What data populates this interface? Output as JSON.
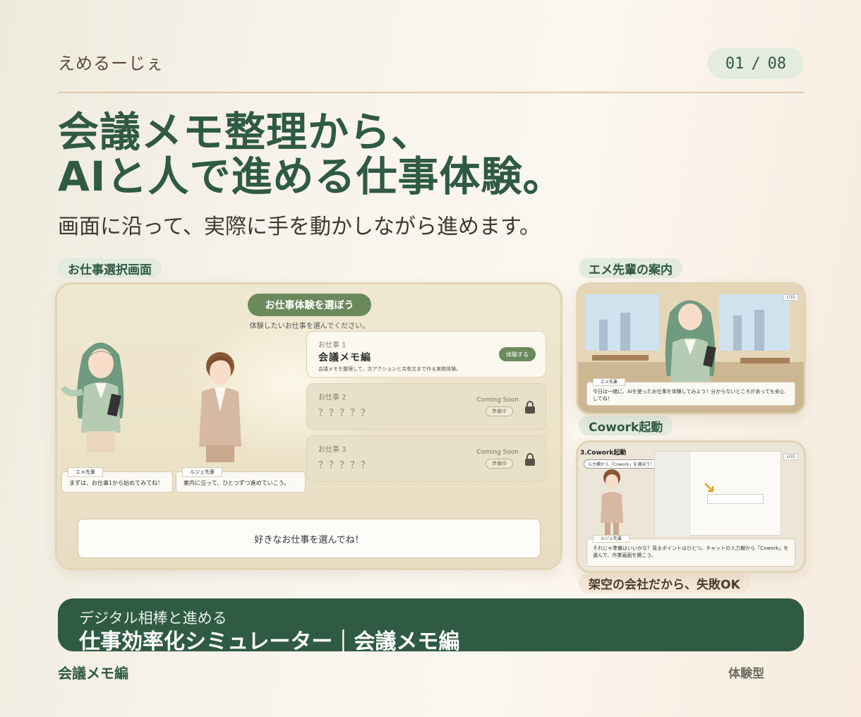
{
  "header": {
    "brand": "えめるーじぇ",
    "page_current": "01",
    "page_sep": "/",
    "page_total": "08"
  },
  "hero": {
    "title_line1": "会議メモ整理から、",
    "title_line2": "AIと人で進める仕事体験。",
    "subtitle": "画面に沿って、実際に手を動かしながら進めます。"
  },
  "labels": {
    "main_screen": "お仕事選択画面",
    "guide": "エメ先輩の案内",
    "cowork": "Cowork起動",
    "fail_ok": "架空の会社だから、失敗OK"
  },
  "main_screen": {
    "choose_button": "お仕事体験を選ぼう",
    "choose_sub": "体験したいお仕事を選んでください。",
    "jobs": [
      {
        "tag": "お仕事 1",
        "name": "会議メモ編",
        "desc": "会議メモを整理して、次アクションと共有文まで作る実務体験。",
        "action": "体験する"
      },
      {
        "tag": "お仕事 2",
        "name": "？？？？？",
        "soon": "Coming Soon",
        "status": "準備中"
      },
      {
        "tag": "お仕事 3",
        "name": "？？？？？",
        "soon": "Coming Soon",
        "status": "準備中"
      }
    ],
    "speech_eme_name": "エメ先輩",
    "speech_eme": "まずは、お仕事1から始めてみてね！",
    "speech_ruje_name": "ルジェ先輩",
    "speech_ruje": "案内に沿って、ひとつずつ進めていこう。",
    "bottom_message": "好きなお仕事を選んでね！"
  },
  "guide_screen": {
    "log": "LOG",
    "speaker": "エメ先輩",
    "text": "今日は一緒に、AIを使ったお仕事を体験してみよう！分からないところがあっても安心してね！"
  },
  "cowork_screen": {
    "heading": "3.Cowork起動",
    "hint": "入力欄から「Cowork」を選ぼう！",
    "log": "LOG",
    "speaker": "ルジェ先輩",
    "text": "それじゃ準備はいいかな？見るポイントはひとつ。チャットの入力欄から「Cowork」を選んで、作業画面を開こう。"
  },
  "banner": {
    "sub": "デジタル相棒と進める",
    "main": "仕事効率化シミュレーター｜会議メモ編"
  },
  "footer": {
    "left": "会議メモ編",
    "right": "体験型"
  },
  "colors": {
    "primary": "#2f5a44",
    "accent_button": "#6b8a5c",
    "rule": "#dcc9a4"
  }
}
